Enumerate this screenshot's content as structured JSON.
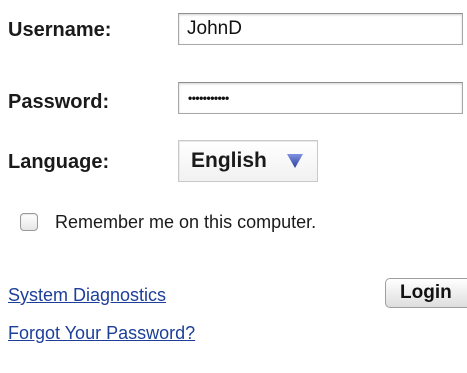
{
  "form": {
    "username_label": "Username:",
    "username_value": "JohnD",
    "password_label": "Password:",
    "password_mask": "•••••••••••",
    "language_label": "Language:",
    "language_selected": "English",
    "remember_label": "Remember me on this computer.",
    "remember_checked": false,
    "login_button": "Login"
  },
  "links": {
    "diagnostics": "System Diagnostics",
    "forgot_password": "Forgot Your Password?"
  },
  "colors": {
    "link": "#1d3f9a",
    "select_arrow": "#3a4fb0"
  },
  "icons": {
    "select_arrow": "chevron-down-icon"
  }
}
